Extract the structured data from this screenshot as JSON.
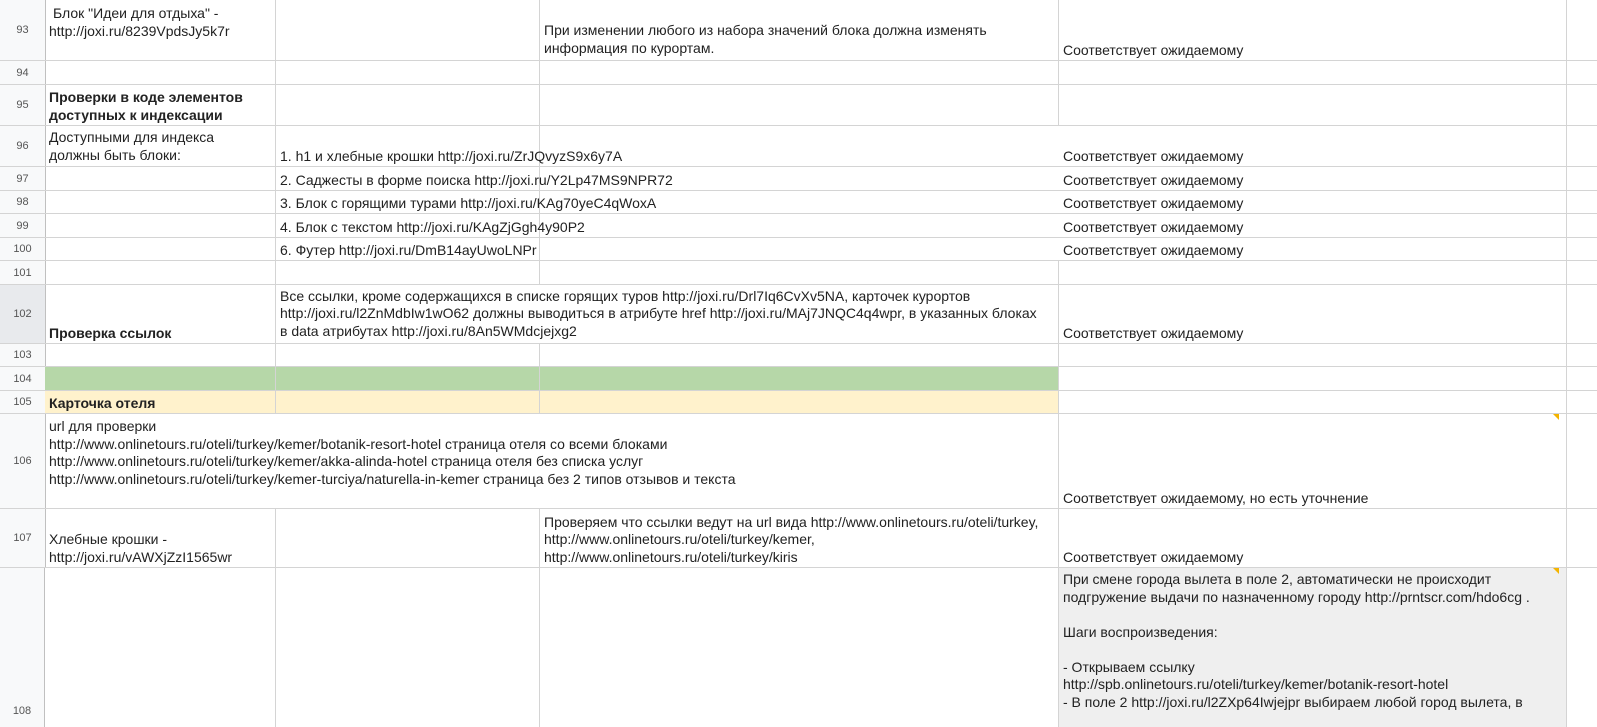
{
  "sheet": {
    "rows": {
      "r93": {
        "num": "93",
        "a": [
          "Блок \"Идеи для отдыха\" -",
          "http://joxi.ru/8239VpdsJy5k7r"
        ],
        "c": [
          "При изменении любого из набора значений блока должна изменять",
          "информация по курортам."
        ],
        "d": "Соответствует ожидаемому"
      },
      "r94": {
        "num": "94"
      },
      "r95": {
        "num": "95",
        "a": [
          "Проверки в коде элементов",
          "доступных к индексации"
        ]
      },
      "r96": {
        "num": "96",
        "a": [
          "Доступными для индекса",
          "должны быть блоки:"
        ],
        "b": "1. h1 и хлебные крошки http://joxi.ru/ZrJQvyzS9x6y7A",
        "d": "Соответствует ожидаемому"
      },
      "r97": {
        "num": "97",
        "b": "2. Саджесты в форме поиска http://joxi.ru/Y2Lp47MS9NPR72",
        "d": "Соответствует ожидаемому"
      },
      "r98": {
        "num": "98",
        "b": "3. Блок с горящими турами http://joxi.ru/KAg70yeC4qWoxA",
        "d": "Соответствует ожидаемому"
      },
      "r99": {
        "num": "99",
        "b": "4. Блок с текстом http://joxi.ru/KAgZjGgh4y90P2",
        "d": "Соответствует ожидаемому"
      },
      "r100": {
        "num": "100",
        "b": "6. Футер http://joxi.ru/DmB14ayUwoLNPr",
        "d": "Соответствует ожидаемому"
      },
      "r101": {
        "num": "101"
      },
      "r102": {
        "num": "102",
        "a": "Проверка ссылок",
        "b": [
          "Все ссылки, кроме содержащихся в списке горящих туров http://joxi.ru/Drl7Iq6CvXv5NA, карточек курортов",
          "http://joxi.ru/l2ZnMdbIw1wO62 должны выводиться в атрибуте href http://joxi.ru/MAj7JNQC4q4wpr, в указанных блоках",
          "в data атрибутах http://joxi.ru/8An5WMdcjejxg2"
        ],
        "d": "Соответствует ожидаемому"
      },
      "r103": {
        "num": "103"
      },
      "r104": {
        "num": "104"
      },
      "r105": {
        "num": "105",
        "a": "Карточка отеля"
      },
      "r106": {
        "num": "106",
        "a": [
          "url для проверки",
          "http://www.onlinetours.ru/oteli/turkey/kemer/botanik-resort-hotel страница отеля со всеми блоками",
          "http://www.onlinetours.ru/oteli/turkey/kemer/akka-alinda-hotel страница отеля без списка услуг",
          "http://www.onlinetours.ru/oteli/turkey/kemer-turciya/naturella-in-kemer страница без 2 типов отзывов и текста"
        ],
        "d": "Соответствует ожидаемому, но есть уточнение"
      },
      "r107": {
        "num": "107",
        "a": [
          "Хлебные крошки -",
          "http://joxi.ru/vAWXjZzI1565wr"
        ],
        "c": [
          "Проверяем что ссылки ведут на url вида http://www.onlinetours.ru/oteli/turkey,",
          "http://www.onlinetours.ru/oteli/turkey/kemer,",
          "http://www.onlinetours.ru/oteli/turkey/kiris"
        ],
        "d": "Соответствует ожидаемому"
      },
      "r108": {
        "num": "108",
        "d": [
          "При смене города вылета в поле 2, автоматически не происходит",
          "подгружение выдачи по назначенному городу http://prntscr.com/hdo6cg .",
          "",
          "Шаги воспроизведения:",
          "",
          "- Открываем ссылку",
          "http://spb.onlinetours.ru/oteli/turkey/kemer/botanik-resort-hotel",
          "- В поле 2 http://joxi.ru/l2ZXp64Iwjejpr выбираем любой город вылета, в"
        ]
      }
    },
    "colors": {
      "green": "#b6d7a8",
      "yellow": "#fff2cc",
      "note": "#f4b400",
      "note_cell": "#efefef"
    }
  }
}
